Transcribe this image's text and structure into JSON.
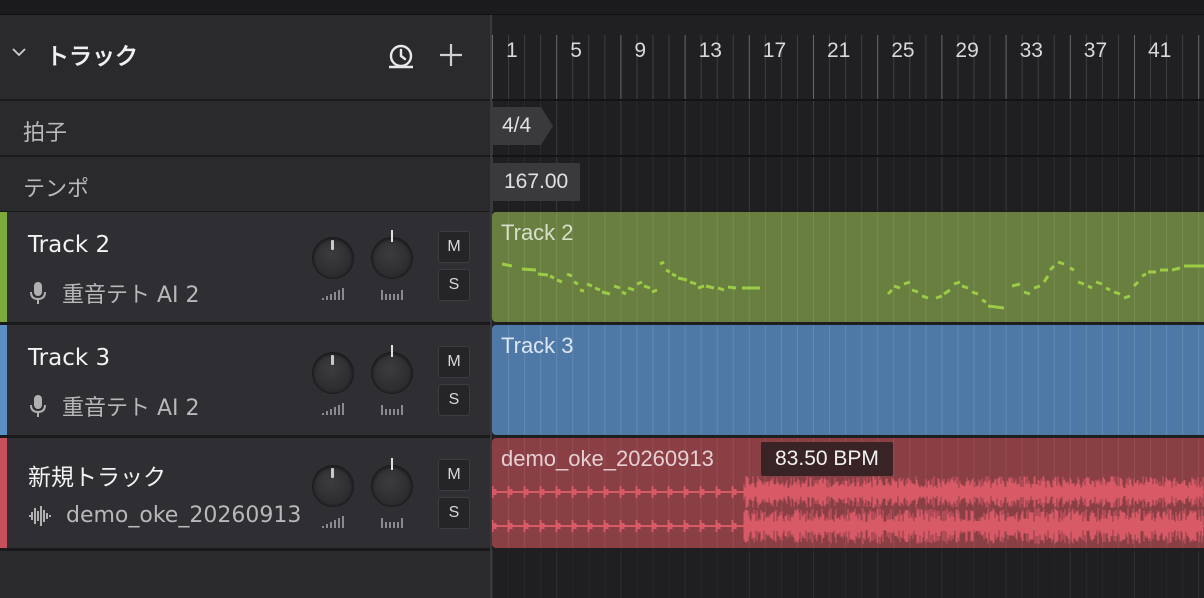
{
  "header": {
    "title": "トラック"
  },
  "rows": [
    {
      "label": "拍子"
    },
    {
      "label": "テンポ"
    }
  ],
  "timeline": {
    "bars": [
      "1",
      "5",
      "9",
      "13",
      "17",
      "21",
      "25",
      "29",
      "33",
      "37",
      "41"
    ],
    "time_signature": "4/4",
    "tempo": "167.00"
  },
  "tracks": [
    {
      "name": "Track 2",
      "voice": "重音テト AI 2",
      "kind": "vocal",
      "color": "#7da83c",
      "clip_color": "#687f3f",
      "clip_name": "Track 2",
      "mute": "M",
      "solo": "S"
    },
    {
      "name": "Track 3",
      "voice": "重音テト AI 2",
      "kind": "vocal",
      "color": "#5b8fc4",
      "clip_color": "#4e79a6",
      "clip_name": "Track 3",
      "mute": "M",
      "solo": "S"
    },
    {
      "name": "新規トラック",
      "voice": "demo_oke_20260913",
      "kind": "audio",
      "color": "#c8505a",
      "clip_color": "#8a3f45",
      "clip_name": "demo_oke_20260913",
      "bpm": "83.50 BPM",
      "mute": "M",
      "solo": "S"
    }
  ],
  "icons": {
    "collapse": "chevron-down-icon",
    "history": "history-icon",
    "add": "plus-icon",
    "vocal": "microphone-icon",
    "audio": "waveform-icon"
  }
}
